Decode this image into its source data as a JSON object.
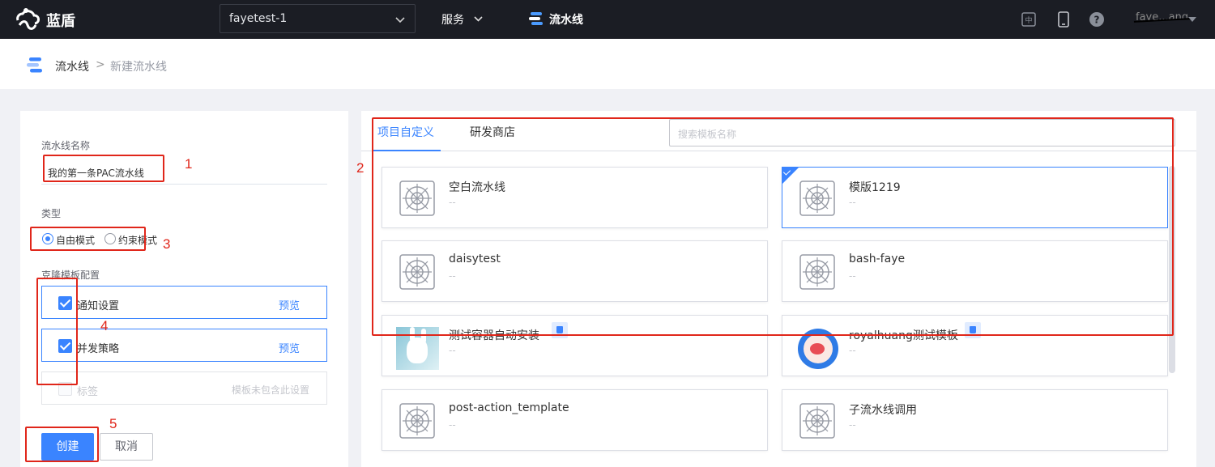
{
  "navbar": {
    "brand": "蓝盾",
    "project": "fayetest-1",
    "services_label": "服务",
    "pipeline_label": "流水线",
    "user": "faye...ang"
  },
  "breadcrumb": {
    "root": "流水线",
    "separator": ">",
    "current": "新建流水线"
  },
  "form": {
    "name_label": "流水线名称",
    "name_value": "我的第一条PAC流水线",
    "type_label": "类型",
    "type_options": [
      "自由模式",
      "约束模式"
    ],
    "type_selected": "自由模式",
    "clone_label": "克隆模板配置",
    "clone_items": [
      {
        "label": "通知设置",
        "checked": true,
        "action": "预览"
      },
      {
        "label": "并发策略",
        "checked": true,
        "action": "预览"
      },
      {
        "label": "标签",
        "checked": false,
        "action": "模板未包含此设置"
      }
    ],
    "create_label": "创建",
    "cancel_label": "取消"
  },
  "templates": {
    "tabs": [
      "项目自定义",
      "研发商店"
    ],
    "active_tab": "项目自定义",
    "search_placeholder": "搜索模板名称",
    "cards": [
      {
        "name": "空白流水线",
        "desc": "--",
        "icon": "pipeline-template-icon",
        "selected": false
      },
      {
        "name": "模版1219",
        "desc": "--",
        "icon": "pipeline-template-icon",
        "selected": true
      },
      {
        "name": "daisytest",
        "desc": "--",
        "icon": "pipeline-template-icon",
        "selected": false
      },
      {
        "name": "bash-faye",
        "desc": "--",
        "icon": "pipeline-template-icon",
        "selected": false
      },
      {
        "name": "测试容器自动安装",
        "desc": "--",
        "icon": "rabbit-image",
        "selected": false,
        "store": true
      },
      {
        "name": "royalhuang测试模板",
        "desc": "--",
        "icon": "circle-logo-image",
        "selected": false,
        "store": true
      },
      {
        "name": "post-action_template",
        "desc": "--",
        "icon": "pipeline-template-icon",
        "selected": false
      },
      {
        "name": "子流水线调用",
        "desc": "--",
        "icon": "pipeline-template-icon",
        "selected": false
      }
    ]
  },
  "annotations": [
    "1",
    "2",
    "3",
    "4",
    "5"
  ],
  "colors": {
    "accent": "#3a84ff",
    "navbar_bg": "#1b1d24",
    "annotation": "#e0261a"
  }
}
